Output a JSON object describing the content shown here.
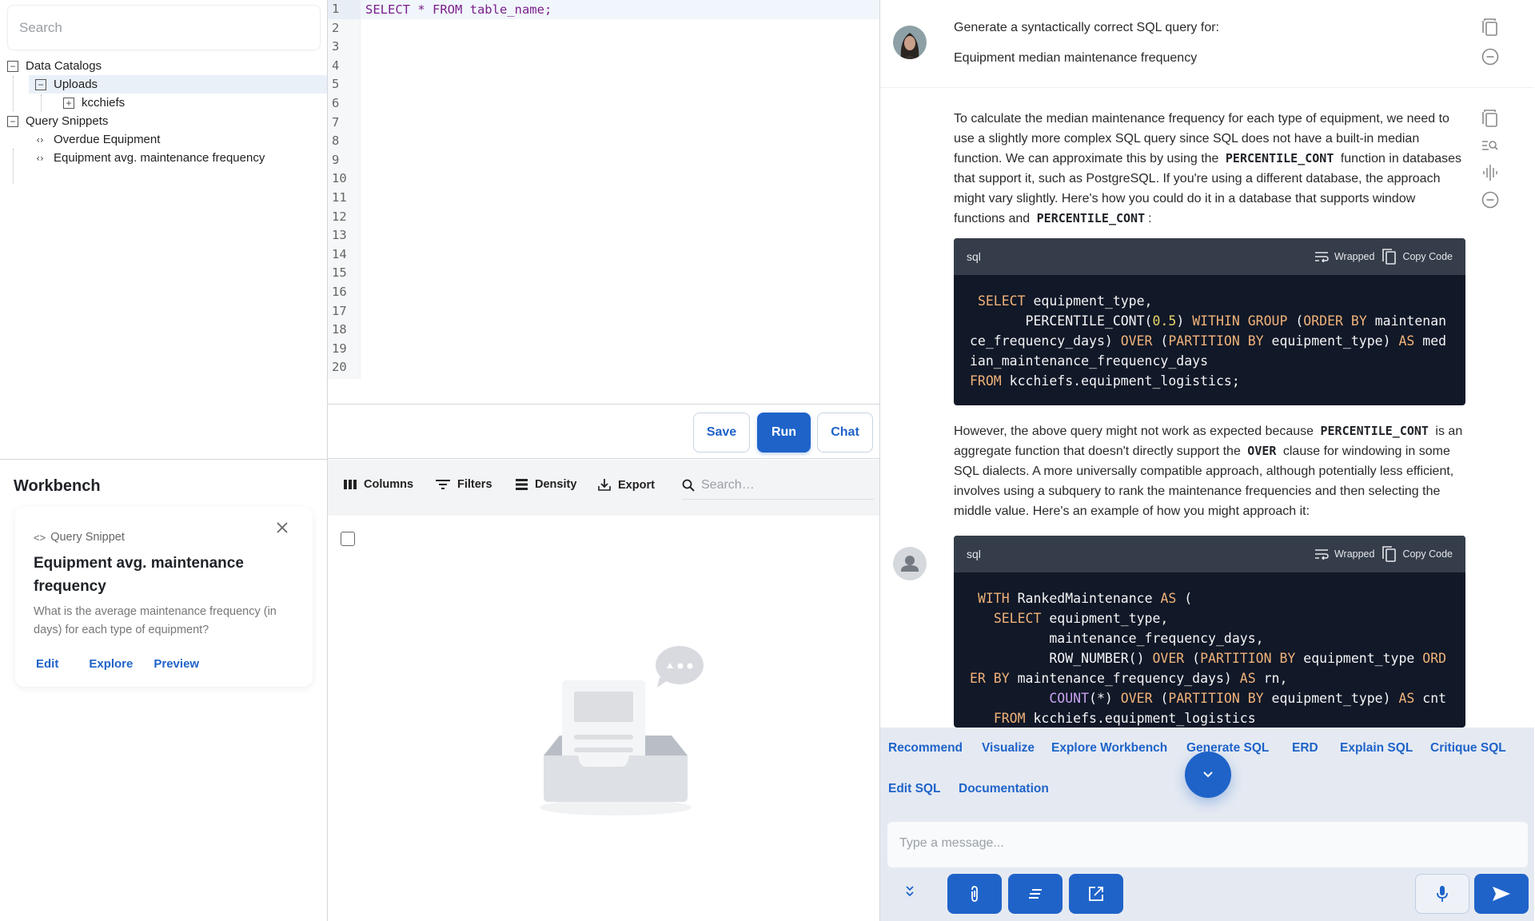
{
  "explorer": {
    "search_placeholder": "Search",
    "tree": [
      {
        "label": "Data Catalogs",
        "expanded": true,
        "level": 0,
        "toggle": "minus"
      },
      {
        "label": "Uploads",
        "expanded": true,
        "level": 1,
        "toggle": "minus",
        "selected": true
      },
      {
        "label": "kcchiefs",
        "expanded": false,
        "level": 2,
        "toggle": "plus"
      },
      {
        "label": "Query Snippets",
        "expanded": true,
        "level": 0,
        "toggle": "minus"
      },
      {
        "label": "Overdue Equipment",
        "level": 1,
        "icon": "code-icon"
      },
      {
        "label": "Equipment avg. maintenance frequency",
        "level": 1,
        "icon": "code-icon"
      }
    ]
  },
  "workbench": {
    "title": "Workbench",
    "card": {
      "kind": "Query Snippet",
      "kind_icon": "<>",
      "name": "Equipment avg. maintenance frequency",
      "description": "What is the average maintenance frequency (in days) for each type of equipment?",
      "actions": [
        "Edit",
        "Explore",
        "Preview"
      ]
    }
  },
  "editor": {
    "line_numbers": [
      "1",
      "2",
      "3",
      "4",
      "5",
      "6",
      "7",
      "8",
      "9",
      "10",
      "11",
      "12",
      "13",
      "14",
      "15",
      "16",
      "17",
      "18",
      "19",
      "20"
    ],
    "code": "SELECT * FROM table_name;",
    "buttons": {
      "save": "Save",
      "run": "Run",
      "chat": "Chat"
    }
  },
  "results": {
    "toolbar": {
      "columns": "Columns",
      "filters": "Filters",
      "density": "Density",
      "export": "Export",
      "search_placeholder": "Search…"
    }
  },
  "chat": {
    "user_message": {
      "line1": "Generate a syntactically correct SQL query for:",
      "line2": "Equipment median maintenance frequency"
    },
    "assistant_message": {
      "para1_a": "To calculate the median maintenance frequency for each type of equipment, we need to use a slightly more complex SQL query since SQL does not have a built-in median function. We can approximate this by using the",
      "para1_code1": "PERCENTILE_CONT",
      "para1_b": "function in databases that support it, such as PostgreSQL. If you're using a different database, the approach might vary slightly. Here's how you could do it in a database that supports window functions and",
      "para1_code2": "PERCENTILE_CONT",
      "para1_c": ":",
      "code1": {
        "lang": "sql",
        "wrapped_label": "Wrapped",
        "copy_label": "Copy Code"
      },
      "para2_a": "However, the above query might not work as expected because",
      "para2_code1": "PERCENTILE_CONT",
      "para2_b": "is an aggregate function that doesn't directly support the",
      "para2_code2": "OVER",
      "para2_c": "clause for windowing in some SQL dialects. A more universally compatible approach, although potentially less efficient, involves using a subquery to rank the maintenance frequencies and then selecting the middle value. Here's an example of how you might approach it:",
      "code2": {
        "lang": "sql",
        "wrapped_label": "Wrapped",
        "copy_label": "Copy Code"
      }
    },
    "quick_actions": [
      "Recommend",
      "Visualize",
      "Explore Workbench",
      "Generate SQL",
      "ERD",
      "Explain SQL",
      "Critique SQL",
      "Edit SQL",
      "Documentation"
    ],
    "input_placeholder": "Type a message...",
    "accent_color": "#1f63c9"
  }
}
